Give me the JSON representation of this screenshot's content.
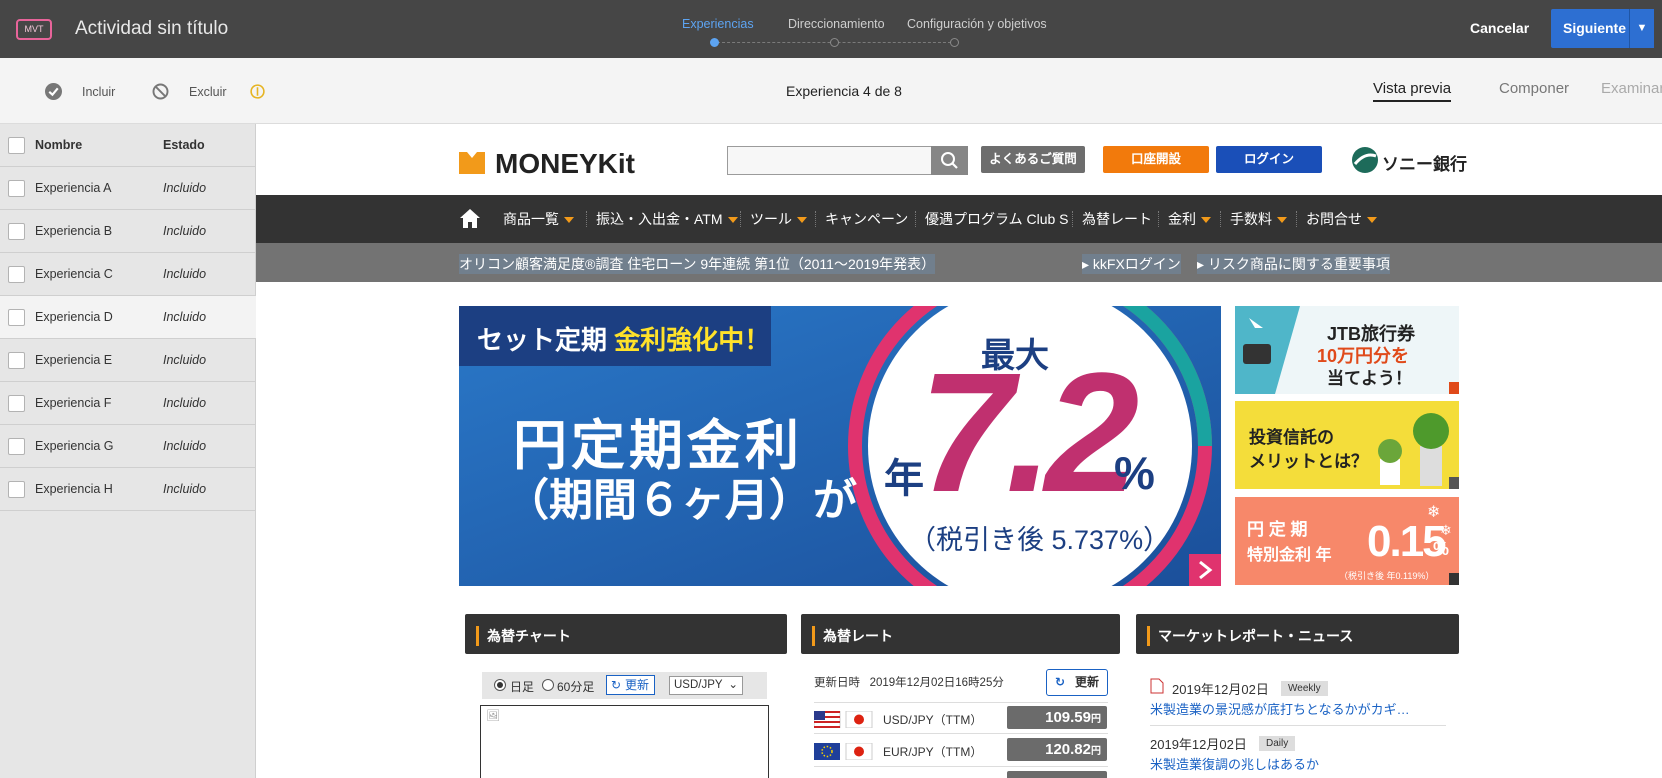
{
  "header": {
    "badge": "MVT",
    "title": "Actividad sin título",
    "steps": [
      {
        "label": "Experiencias",
        "active": true
      },
      {
        "label": "Direccionamiento",
        "active": false
      },
      {
        "label": "Configuración y objetivos",
        "active": false
      }
    ],
    "cancel_label": "Cancelar",
    "next_label": "Siguiente",
    "next_menu_icon": "chevron-down-icon"
  },
  "toolbar": {
    "include_label": "Incluir",
    "exclude_label": "Excluir",
    "counter": "Experiencia 4 de 8",
    "tabs": [
      {
        "label": "Vista previa",
        "active": true
      },
      {
        "label": "Componer",
        "active": false
      },
      {
        "label": "Examinar",
        "active": false
      }
    ]
  },
  "sidebar": {
    "col_name": "Nombre",
    "col_status": "Estado",
    "rows": [
      {
        "name": "Experiencia A",
        "status": "Incluido"
      },
      {
        "name": "Experiencia B",
        "status": "Incluido"
      },
      {
        "name": "Experiencia C",
        "status": "Incluido"
      },
      {
        "name": "Experiencia D",
        "status": "Incluido",
        "selected": true
      },
      {
        "name": "Experiencia E",
        "status": "Incluido"
      },
      {
        "name": "Experiencia F",
        "status": "Incluido"
      },
      {
        "name": "Experiencia G",
        "status": "Incluido"
      },
      {
        "name": "Experiencia H",
        "status": "Incluido"
      }
    ]
  },
  "site": {
    "logo_text": "MONEYKit",
    "buttons": {
      "faq": "よくあるご質問",
      "open_account": "口座開設",
      "login": "ログイン"
    },
    "bank_name": "ソニー銀行",
    "nav": [
      "商品一覧",
      "振込・入出金・ATM",
      "ツール",
      "キャンペーン",
      "優遇プログラム Club S",
      "為替レート",
      "金利",
      "手数料",
      "お問合せ"
    ],
    "subbar": {
      "notice": "オリコン顧客満足度®調査 住宅ローン 9年連続 第1位（2011〜2019年発表）",
      "fx_login": "kkFXログイン",
      "risk_link": "リスク商品に関する重要事項"
    },
    "hero": {
      "tag_prefix": "セット定期 ",
      "tag_highlight": "金利強化中！",
      "line1": "円定期金利",
      "line2": "（期間６ヶ月）が",
      "max_label": "最大",
      "year_label": "年",
      "rate": "7.2",
      "percent": "%",
      "after_tax": "（税引き後 5.737%）"
    },
    "side_banners": {
      "jtb_line1": "JTB旅行券",
      "jtb_line2": "10万円分を",
      "jtb_line3": "当てよう！",
      "invest_line1": "投資信託の",
      "invest_line2": "メリットとは？",
      "special_line1": "円 定 期",
      "special_line2": "特別金利 年",
      "special_rate": "0.15",
      "special_percent": "%",
      "special_note": "（税引き後 年0.119%）"
    },
    "panels": {
      "chart_title": "為替チャート",
      "rate_title": "為替レート",
      "news_title": "マーケットレポート・ニュース"
    },
    "chart_controls": {
      "daily": "日足",
      "min60": "60分足",
      "refresh": "更新",
      "pair": "USD/JPY"
    },
    "rates": {
      "updated_label": "更新日時",
      "updated_value": "2019年12月02日16時25分",
      "refresh": "更新",
      "rows": [
        {
          "pair": "USD/JPY（TTM）",
          "value": "109.59",
          "unit": "円"
        },
        {
          "pair": "EUR/JPY（TTM）",
          "value": "120.82",
          "unit": "円"
        }
      ]
    },
    "news": [
      {
        "date": "2019年12月02日",
        "tag": "Weekly",
        "title": "米製造業の景況感が底打ちとなるかがカギ…"
      },
      {
        "date": "2019年12月02日",
        "tag": "Daily",
        "title": "米製造業復調の兆しはあるか"
      }
    ]
  },
  "colors": {
    "accent_blue": "#2d6fd2",
    "brand_orange": "#f29a1a",
    "step_active": "#5da4f2"
  }
}
